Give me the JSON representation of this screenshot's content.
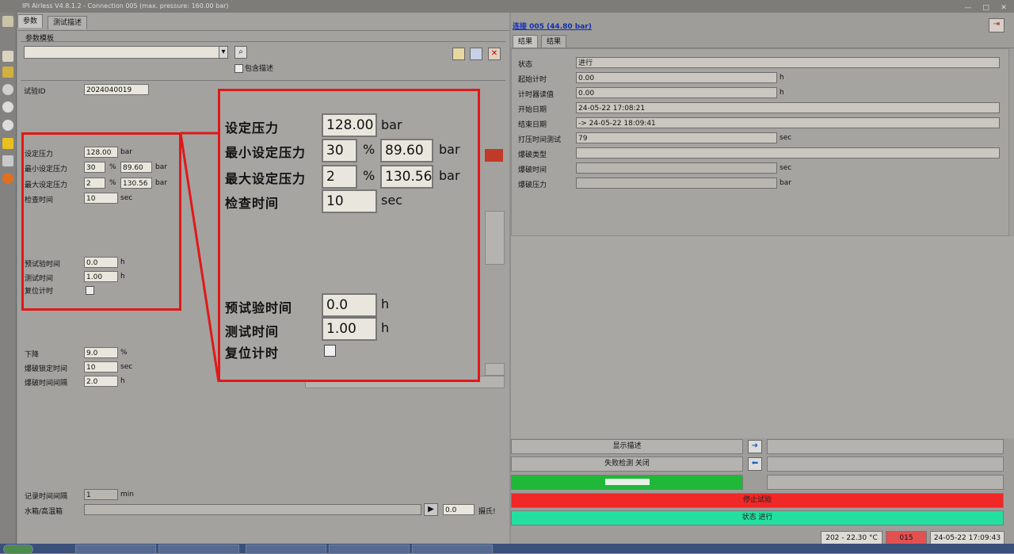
{
  "window": {
    "title": "IPI Airless V4.8.1.2 - Connection 005 (max. pressure: 160.00 bar)"
  },
  "left_tabs": [
    "参数",
    "测试描述"
  ],
  "template": {
    "group_label": "参数模板",
    "include_desc_label": "包含描述"
  },
  "test_id": {
    "label": "试验ID",
    "value": "2024040019"
  },
  "params": {
    "set_pressure": {
      "label": "设定压力",
      "value": "128.00",
      "unit": "bar"
    },
    "min_pressure": {
      "label": "最小设定压力",
      "pct": "30",
      "pct_unit": "%",
      "value": "89.60",
      "unit": "bar"
    },
    "max_pressure": {
      "label": "最大设定压力",
      "pct": "2",
      "pct_unit": "%",
      "value": "130.56",
      "unit": "bar"
    },
    "check_time": {
      "label": "检查时间",
      "value": "10",
      "unit": "sec"
    },
    "pretest_time": {
      "label": "预试验时间",
      "value": "0.0",
      "unit": "h"
    },
    "test_time": {
      "label": "测试时间",
      "value": "1.00",
      "unit": "h"
    },
    "reset_timer": {
      "label": "复位计时"
    }
  },
  "burst": {
    "drop": {
      "label": "下降",
      "value": "9.0",
      "unit": "%"
    },
    "lock_time": {
      "label": "爆破锁定时间",
      "value": "10",
      "unit": "sec"
    },
    "interval": {
      "label": "爆破时间间隔",
      "value": "2.0",
      "unit": "h"
    }
  },
  "record": {
    "interval": {
      "label": "记录时间间隔",
      "value": "1",
      "unit": "min"
    },
    "tank": {
      "label": "水箱/高温箱",
      "value": "0.0",
      "unit": "摄氏!"
    }
  },
  "right": {
    "connection_title": "连接 005 (44.80 bar)",
    "tabs": [
      "结果",
      "结果"
    ],
    "rows": [
      {
        "label": "状态",
        "value": "进行",
        "unit": ""
      },
      {
        "label": "起始计时",
        "value": "0.00",
        "unit": "h"
      },
      {
        "label": "计时器读值",
        "value": "0.00",
        "unit": "h"
      },
      {
        "label": "开始日期",
        "value": "24-05-22 17:08:21",
        "unit": ""
      },
      {
        "label": "结束日期",
        "value": "-> 24-05-22 18:09:41",
        "unit": ""
      },
      {
        "label": "打压时间测试",
        "value": "79",
        "unit": "sec"
      },
      {
        "label": "爆破类型",
        "value": "",
        "unit": ""
      },
      {
        "label": "爆破时间",
        "value": "",
        "unit": "sec"
      },
      {
        "label": "爆破压力",
        "value": "",
        "unit": "bar"
      }
    ],
    "show_desc_label": "显示描述",
    "fail_detect_label": "失败检测 关闭",
    "stop_test_label": "停止试验",
    "status_label": "状态 进行"
  },
  "statusbar": {
    "temp": "202 - 22.30 °C",
    "conn": "015",
    "datetime": "24-05-22 17:09:43"
  },
  "colors": {
    "highlight": "#e01818",
    "green": "#1fb838",
    "red": "#f02828",
    "teal": "#24e0a0"
  }
}
